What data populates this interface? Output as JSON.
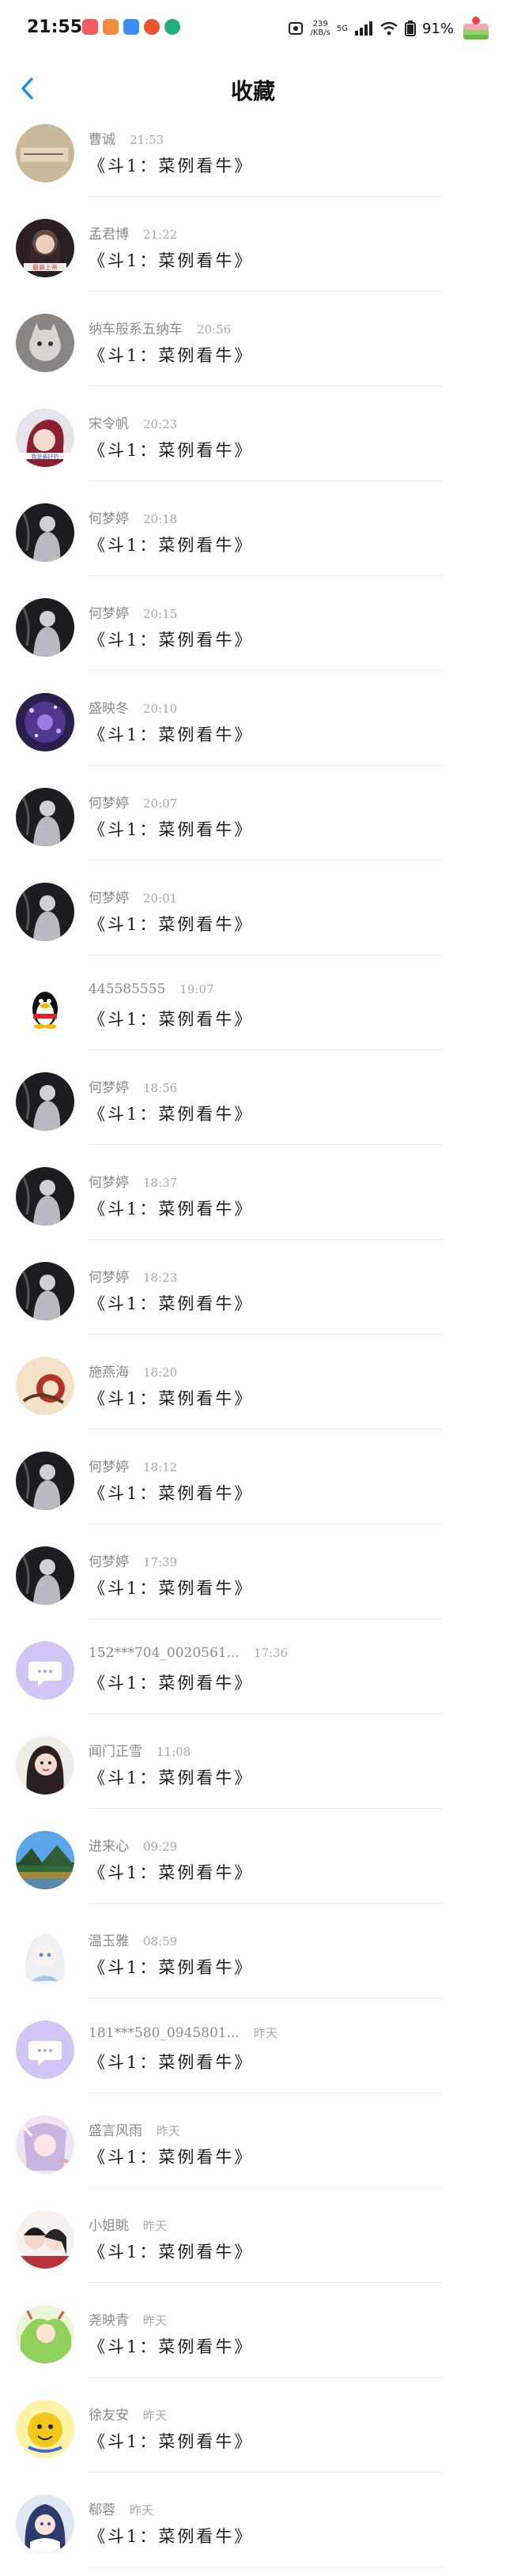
{
  "status_bar": {
    "time": "21:55",
    "net_speed": "239",
    "net_unit": "/KB/s",
    "signal": "5G",
    "battery": "91%"
  },
  "nav": {
    "title": "收藏",
    "back_icon": "chevron-left-icon"
  },
  "colors": {
    "accent": "#1d8ff5",
    "divider": "#ececec",
    "name_text": "#8a8a8a",
    "message_text": "#1a1a1a"
  },
  "items": [
    {
      "name": "曹诚",
      "time": "21:53",
      "message": "《斗1：菜例看牛》",
      "avatar": "beige"
    },
    {
      "name": "孟君博",
      "time": "21:22",
      "message": "《斗1：菜例看牛》",
      "avatar": "girl-dark"
    },
    {
      "name": "纳车般系五纳车",
      "time": "20:56",
      "message": "《斗1：菜例看牛》",
      "avatar": "cat-gray"
    },
    {
      "name": "宋令帆",
      "time": "20:23",
      "message": "《斗1：菜例看牛》",
      "avatar": "red-hair"
    },
    {
      "name": "何梦婷",
      "time": "20:18",
      "message": "《斗1：菜例看牛》",
      "avatar": "dark-figure"
    },
    {
      "name": "何梦婷",
      "time": "20:15",
      "message": "《斗1：菜例看牛》",
      "avatar": "dark-figure"
    },
    {
      "name": "盛映冬",
      "time": "20:10",
      "message": "《斗1：菜例看牛》",
      "avatar": "purple-sparkle"
    },
    {
      "name": "何梦婷",
      "time": "20:07",
      "message": "《斗1：菜例看牛》",
      "avatar": "dark-figure"
    },
    {
      "name": "何梦婷",
      "time": "20:01",
      "message": "《斗1：菜例看牛》",
      "avatar": "dark-figure"
    },
    {
      "name": "445585555",
      "time": "19:07",
      "message": "《斗1：菜例看牛》",
      "avatar": "penguin"
    },
    {
      "name": "何梦婷",
      "time": "18:56",
      "message": "《斗1：菜例看牛》",
      "avatar": "dark-figure"
    },
    {
      "name": "何梦婷",
      "time": "18:37",
      "message": "《斗1：菜例看牛》",
      "avatar": "dark-figure"
    },
    {
      "name": "何梦婷",
      "time": "18:23",
      "message": "《斗1：菜例看牛》",
      "avatar": "dark-figure"
    },
    {
      "name": "施燕海",
      "time": "18:20",
      "message": "《斗1：菜例看牛》",
      "avatar": "warm-art"
    },
    {
      "name": "何梦婷",
      "time": "18:12",
      "message": "《斗1：菜例看牛》",
      "avatar": "dark-figure"
    },
    {
      "name": "何梦婷",
      "time": "17:39",
      "message": "《斗1：菜例看牛》",
      "avatar": "dark-figure"
    },
    {
      "name": "152***704_0020561...",
      "time": "17:36",
      "message": "《斗1：菜例看牛》",
      "avatar": "default-chat"
    },
    {
      "name": "闻门正雪",
      "time": "11:08",
      "message": "《斗1：菜例看牛》",
      "avatar": "girl-portrait"
    },
    {
      "name": "进来心",
      "time": "09:29",
      "message": "《斗1：菜例看牛》",
      "avatar": "landscape"
    },
    {
      "name": "温玉雅",
      "time": "08:59",
      "message": "《斗1：菜例看牛》",
      "avatar": "white-anime"
    },
    {
      "name": "181***580_0945801...",
      "time": "昨天",
      "message": "《斗1：菜例看牛》",
      "avatar": "default-chat"
    },
    {
      "name": "盛言风雨",
      "time": "昨天",
      "message": "《斗1：菜例看牛》",
      "avatar": "pink-anime"
    },
    {
      "name": "小姐眺",
      "time": "昨天",
      "message": "《斗1：菜例看牛》",
      "avatar": "couple"
    },
    {
      "name": "尧映青",
      "time": "昨天",
      "message": "《斗1：菜例看牛》",
      "avatar": "green-anime"
    },
    {
      "name": "徐友安",
      "time": "昨天",
      "message": "《斗1：菜例看牛》",
      "avatar": "yellow-char"
    },
    {
      "name": "郗蓉",
      "time": "昨天",
      "message": "《斗1：菜例看牛》",
      "avatar": "blue-anime"
    }
  ]
}
